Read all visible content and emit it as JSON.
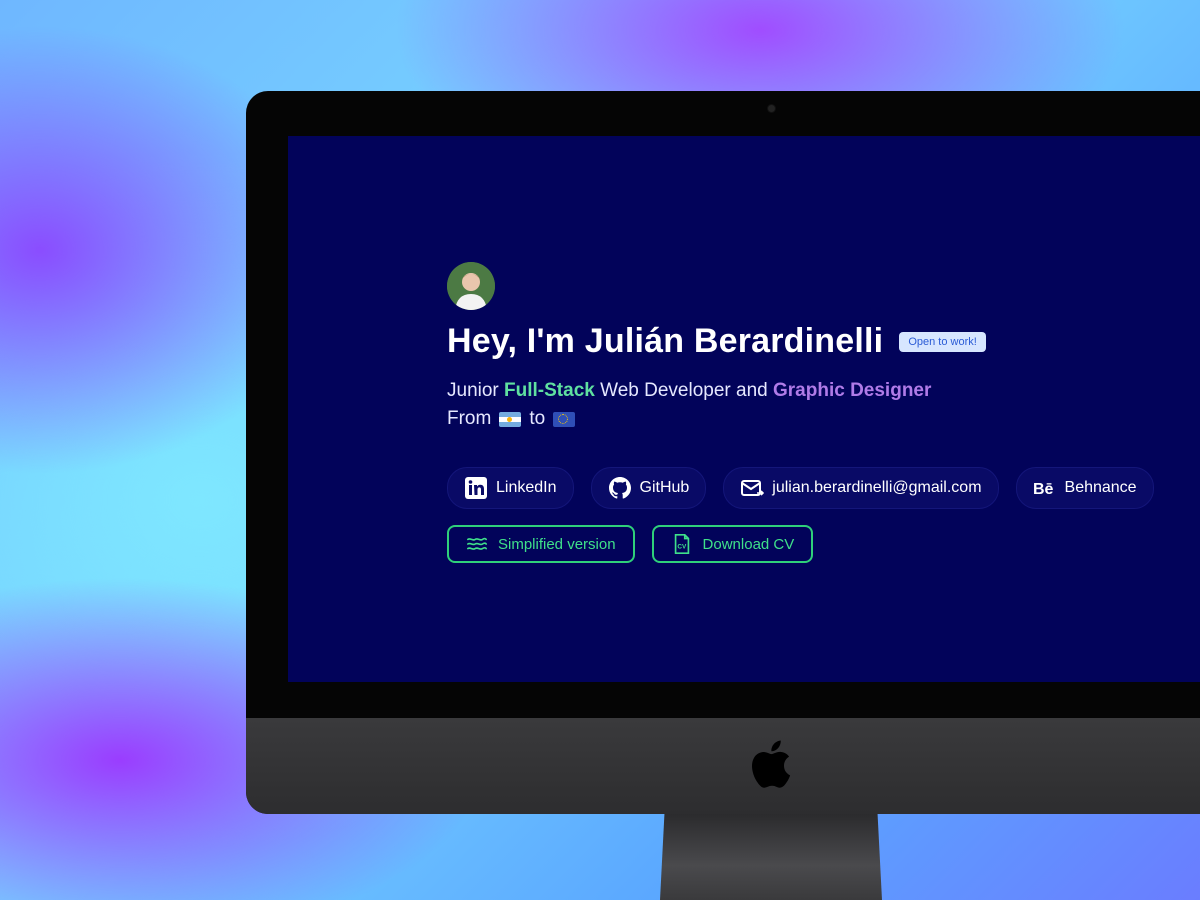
{
  "hero": {
    "greeting": "Hey, I'm Julián Berardinelli",
    "badge": "Open to work!",
    "subtitle_prefix": "Junior",
    "subtitle_role1": "Full-Stack",
    "subtitle_middle": "Web Developer and",
    "subtitle_role2": "Graphic Designer",
    "from_label": "From",
    "to_label": "to"
  },
  "links": [
    {
      "label": "LinkedIn",
      "icon": "linkedin-icon"
    },
    {
      "label": "GitHub",
      "icon": "github-icon"
    },
    {
      "label": "julian.berardinelli@gmail.com",
      "icon": "mail-icon"
    },
    {
      "label": "Behnance",
      "icon": "behance-icon"
    }
  ],
  "actions": [
    {
      "label": "Simplified version",
      "icon": "waves-icon"
    },
    {
      "label": "Download CV",
      "icon": "cv-file-icon"
    }
  ],
  "colors": {
    "screen_bg": "#02035a",
    "accent_green": "#5fe0a0",
    "accent_purple": "#b07be8",
    "button_border": "#2fd07a",
    "badge_bg": "#d7e6ff"
  }
}
